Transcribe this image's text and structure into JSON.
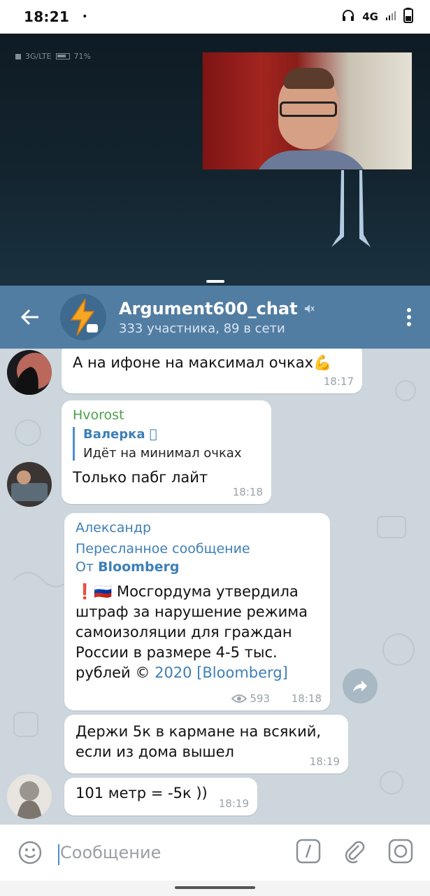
{
  "status": {
    "time": "18:21",
    "dot": "•",
    "network": "4G"
  },
  "video": {
    "mini_status": "3G/LTE",
    "battery": "71%"
  },
  "header": {
    "title": "Argument600_chat",
    "subtitle": "333 участника, 89 в сети"
  },
  "messages": [
    {
      "text": "А на ифоне на максимал очках💪",
      "time": "18:17"
    },
    {
      "sender": "Hvorost",
      "reply_name": "Валерка 🏽",
      "reply_text": "Идёт на минимал очках",
      "text": "Только пабг лайт",
      "time": "18:18"
    },
    {
      "sender": "Александр",
      "forward_label": "Пересланное сообщение",
      "forward_from_prefix": "От",
      "forward_from": "Bloomberg",
      "text": "❗🇷🇺 Мосгордума утвердила штраф за нарушение режима самоизоляции для граждан России в размере 4-5 тыс. рублей",
      "copyright": "©",
      "link": "2020 [Bloomberg]",
      "views": "593",
      "time": "18:18"
    },
    {
      "text": "Держи 5к в кармане на всякий, если из дома вышел",
      "time": "18:19"
    },
    {
      "text": "101 метр = -5к ))",
      "time": "18:19"
    }
  ],
  "input": {
    "placeholder": "Сообщение"
  },
  "colors": {
    "header": "#527da3",
    "accent": "#4c8ed0",
    "sender_green": "#4aa14a",
    "sender_blue": "#3d7fb8"
  }
}
